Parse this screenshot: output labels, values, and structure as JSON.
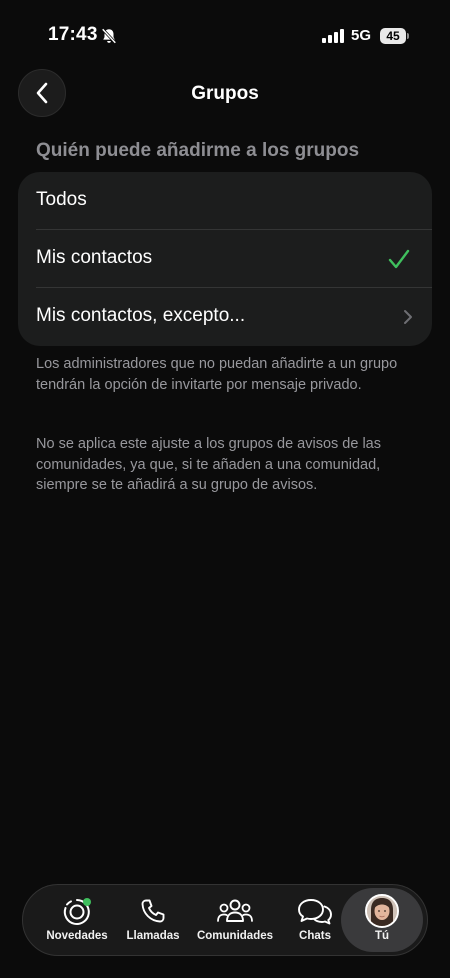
{
  "status_bar": {
    "time": "17:43",
    "network": "5G",
    "battery": "45"
  },
  "header": {
    "title": "Grupos"
  },
  "section": {
    "title": "Quién puede añadirme a los grupos",
    "options": [
      {
        "label": "Todos",
        "selected": false
      },
      {
        "label": "Mis contactos",
        "selected": true
      },
      {
        "label": "Mis contactos, excepto...",
        "selected": false
      }
    ]
  },
  "footnotes": [
    "Los administradores que no puedan añadirte a un grupo tendrán la opción de invitarte por mensaje privado.",
    "No se aplica este ajuste a los grupos de avisos de las comunidades, ya que, si te añaden a una comunidad, siempre se te añadirá a su grupo de avisos."
  ],
  "tab_bar": {
    "tabs": [
      {
        "label": "Novedades",
        "icon": "status-icon"
      },
      {
        "label": "Llamadas",
        "icon": "phone-icon"
      },
      {
        "label": "Comunidades",
        "icon": "communities-icon"
      },
      {
        "label": "Chats",
        "icon": "chats-icon"
      },
      {
        "label": "Tú",
        "icon": "avatar",
        "active": true
      }
    ]
  },
  "colors": {
    "accent_green": "#3fbf5d",
    "background": "#0b0b0b",
    "card": "#1c1d1d"
  }
}
